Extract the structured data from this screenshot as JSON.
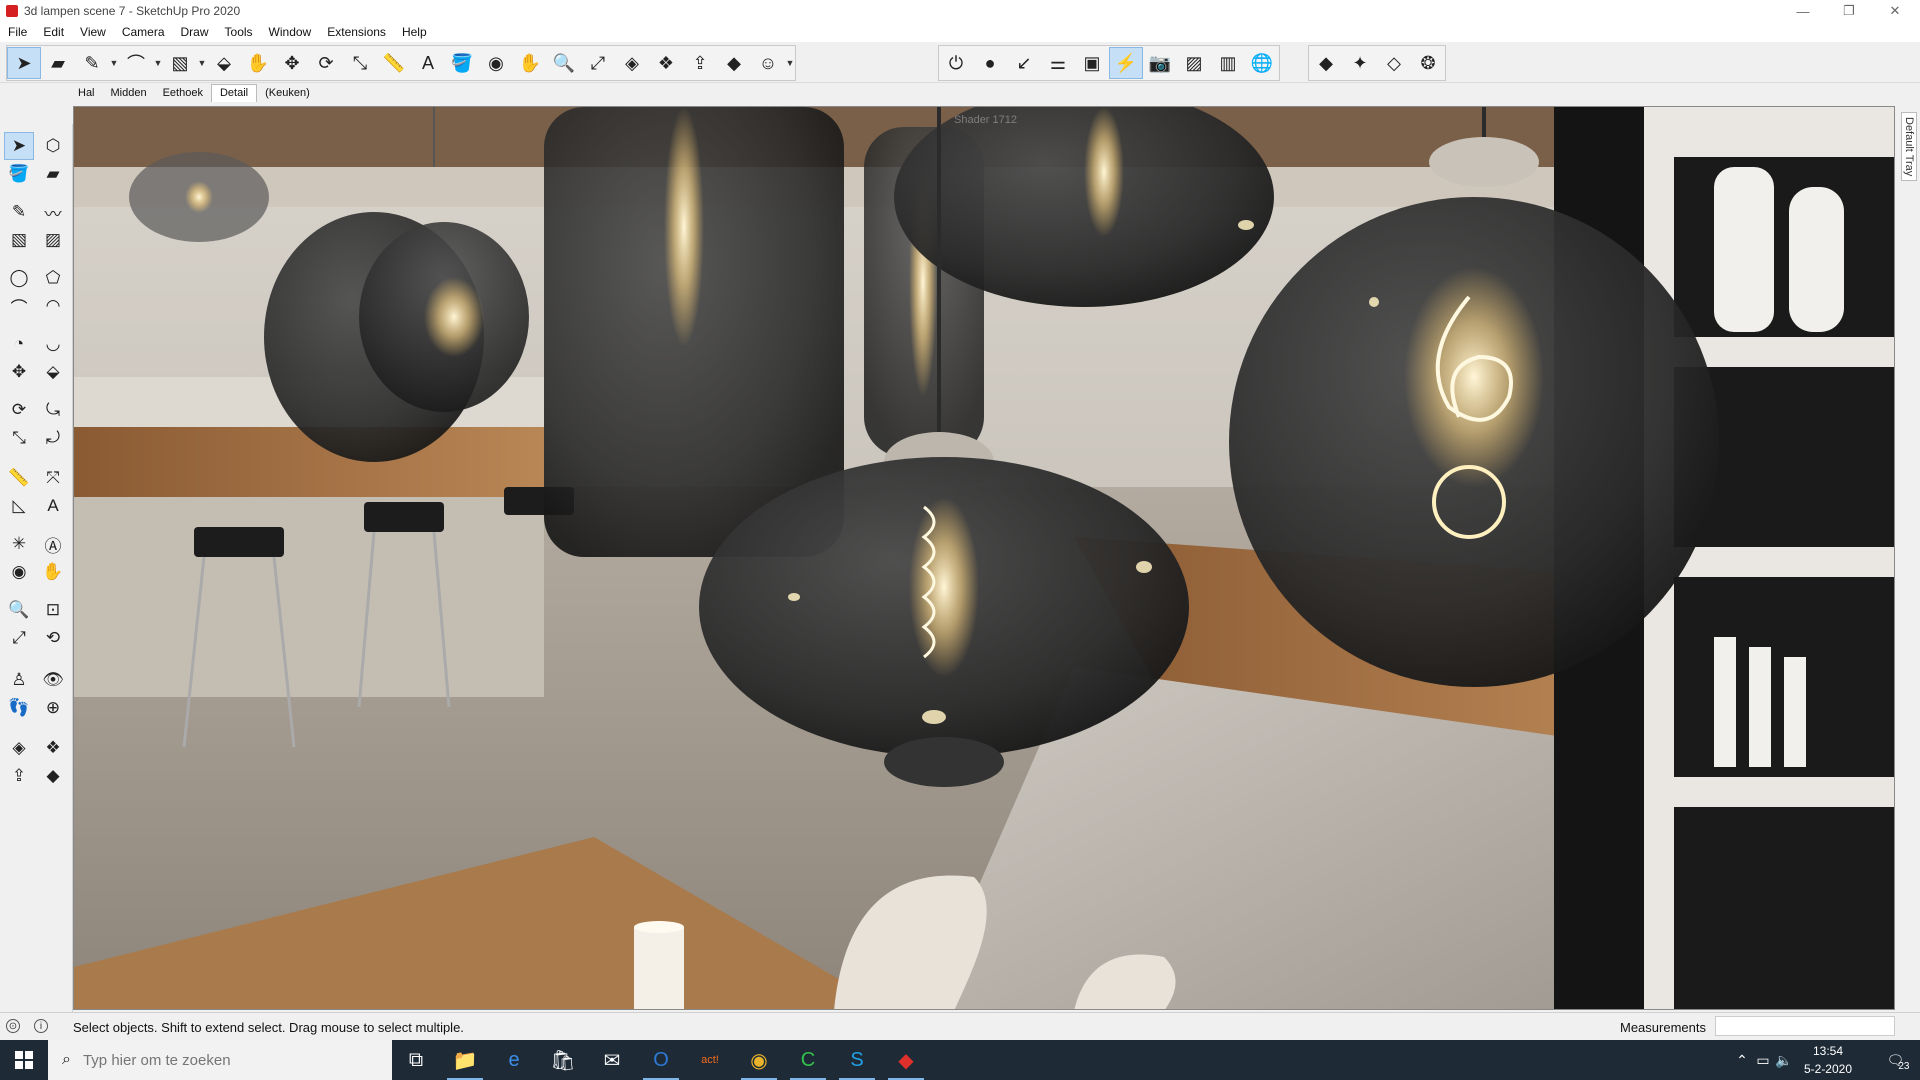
{
  "window": {
    "title": "3d lampen scene 7 - SketchUp Pro 2020",
    "controls": {
      "minimize": "—",
      "maximize": "❐",
      "close": "✕"
    }
  },
  "menu": [
    "File",
    "Edit",
    "View",
    "Camera",
    "Draw",
    "Tools",
    "Window",
    "Extensions",
    "Help"
  ],
  "toolbar": {
    "groups": [
      {
        "items": [
          {
            "icon": "select-icon",
            "glyph": "➤",
            "selected": true
          },
          {
            "icon": "eraser-icon",
            "glyph": "▰"
          },
          {
            "icon": "pencil-icon",
            "glyph": "✎"
          },
          {
            "icon": "dropdown-icon",
            "glyph": "▼",
            "dropdown": true
          },
          {
            "icon": "arc-icon",
            "glyph": "⌒"
          },
          {
            "icon": "dropdown-icon",
            "glyph": "▼",
            "dropdown": true
          },
          {
            "icon": "rectangle-icon",
            "glyph": "▧"
          },
          {
            "icon": "dropdown-icon",
            "glyph": "▼",
            "dropdown": true
          },
          {
            "icon": "push-pull-icon",
            "glyph": "⬙"
          },
          {
            "icon": "follow-me-icon",
            "glyph": "✋"
          },
          {
            "icon": "move-icon",
            "glyph": "✥"
          },
          {
            "icon": "rotate-icon",
            "glyph": "⟳"
          },
          {
            "icon": "scale-icon",
            "glyph": "⤡"
          },
          {
            "icon": "tape-measure-icon",
            "glyph": "📏"
          },
          {
            "icon": "text-icon",
            "glyph": "A"
          },
          {
            "icon": "paint-bucket-icon",
            "glyph": "🪣"
          },
          {
            "icon": "orbit-icon",
            "glyph": "◉"
          },
          {
            "icon": "pan-icon",
            "glyph": "✋"
          },
          {
            "icon": "zoom-icon",
            "glyph": "🔍"
          },
          {
            "icon": "zoom-extents-icon",
            "glyph": "⤢"
          },
          {
            "icon": "warehouse-icon",
            "glyph": "◈"
          },
          {
            "icon": "components-icon",
            "glyph": "❖"
          },
          {
            "icon": "share-model-icon",
            "glyph": "⇪"
          },
          {
            "icon": "extension-warehouse-icon",
            "glyph": "◆"
          },
          {
            "icon": "account-icon",
            "glyph": "☺"
          },
          {
            "icon": "dropdown-icon",
            "glyph": "▼",
            "dropdown": true
          }
        ]
      },
      {
        "items": [
          {
            "icon": "power-icon",
            "glyph": "⏻"
          },
          {
            "icon": "render-icon",
            "glyph": "●"
          },
          {
            "icon": "region-icon",
            "glyph": "↙"
          },
          {
            "icon": "settings-sliders-icon",
            "glyph": "⚌"
          },
          {
            "icon": "frame-buffer-icon",
            "glyph": "▣"
          },
          {
            "icon": "interactive-icon",
            "glyph": "⚡",
            "selected": true
          },
          {
            "icon": "camera-icon",
            "glyph": "📷"
          },
          {
            "icon": "image-icon",
            "glyph": "▨"
          },
          {
            "icon": "chart-icon",
            "glyph": "▥"
          },
          {
            "icon": "globe-icon",
            "glyph": "🌐"
          }
        ]
      },
      {
        "items": [
          {
            "icon": "light-icon",
            "glyph": "◆"
          },
          {
            "icon": "light-mesh-icon",
            "glyph": "✦"
          },
          {
            "icon": "proxy-icon",
            "glyph": "◇"
          },
          {
            "icon": "infinite-plane-icon",
            "glyph": "❂"
          }
        ]
      }
    ]
  },
  "scenes": [
    {
      "label": "Hal",
      "active": false
    },
    {
      "label": "Midden",
      "active": false
    },
    {
      "label": "Eethoek",
      "active": false
    },
    {
      "label": "Detail",
      "active": true
    },
    {
      "label": "(Keuken)",
      "active": false
    }
  ],
  "left_tools": [
    [
      "select-icon",
      "➤"
    ],
    [
      "make-component-icon",
      "⬡"
    ],
    [
      "paint-bucket-icon",
      "🪣"
    ],
    [
      "eraser-icon",
      "▰"
    ],
    [
      "line-icon",
      "✎"
    ],
    [
      "freehand-icon",
      "〰"
    ],
    [
      "rectangle-icon",
      "▧"
    ],
    [
      "rotated-rectangle-icon",
      "▨"
    ],
    [
      "circle-icon",
      "◯"
    ],
    [
      "polygon-icon",
      "⬠"
    ],
    [
      "arc-icon",
      "⌒"
    ],
    [
      "two-point-arc-icon",
      "◠"
    ],
    [
      "pie-icon",
      "◔"
    ],
    [
      "three-point-arc-icon",
      "◡"
    ],
    [
      "move-icon",
      "✥"
    ],
    [
      "push-pull-icon",
      "⬙"
    ],
    [
      "rotate-icon",
      "⟳"
    ],
    [
      "follow-me-icon",
      "⤿"
    ],
    [
      "scale-icon",
      "⤡"
    ],
    [
      "offset-icon",
      "⤾"
    ],
    [
      "tape-measure-icon",
      "📏"
    ],
    [
      "dimension-icon",
      "⤧"
    ],
    [
      "protractor-icon",
      "◺"
    ],
    [
      "text-icon",
      "A"
    ],
    [
      "axes-icon",
      "✳"
    ],
    [
      "3d-text-icon",
      "Ⓐ"
    ],
    [
      "orbit-icon",
      "◉"
    ],
    [
      "pan-icon",
      "✋"
    ],
    [
      "zoom-icon",
      "🔍"
    ],
    [
      "zoom-window-icon",
      "⊡"
    ],
    [
      "zoom-extents-icon",
      "⤢"
    ],
    [
      "previous-view-icon",
      "⟲"
    ],
    [
      "position-camera-icon",
      "♙"
    ],
    [
      "look-around-icon",
      "👁"
    ],
    [
      "walk-icon",
      "👣"
    ],
    [
      "section-plane-icon",
      "⊕"
    ],
    [
      "warehouse-icon",
      "◈"
    ],
    [
      "components-icon",
      "❖"
    ],
    [
      "share-model-icon",
      "⇪"
    ],
    [
      "extension-warehouse-icon",
      "◆"
    ]
  ],
  "viewport": {
    "overlay_text": "Shader 1712"
  },
  "tray": {
    "label": "Default Tray"
  },
  "status": {
    "text": "Select objects. Shift to extend select. Drag mouse to select multiple.",
    "measurements_label": "Measurements",
    "measurements_value": ""
  },
  "taskbar": {
    "search_placeholder": "Typ hier om te zoeken",
    "apps": [
      {
        "icon": "task-view-icon",
        "glyph": "⧉",
        "color": "#ffffff",
        "open": false
      },
      {
        "icon": "file-explorer-icon",
        "glyph": "📁",
        "color": "#f3c23c",
        "open": true
      },
      {
        "icon": "edge-icon",
        "glyph": "e",
        "color": "#3c8ee8",
        "open": false
      },
      {
        "icon": "store-icon",
        "glyph": "🛍",
        "color": "#ffffff",
        "open": false
      },
      {
        "icon": "mail-icon",
        "glyph": "✉",
        "color": "#ffffff",
        "open": false
      },
      {
        "icon": "outlook-icon",
        "glyph": "O",
        "color": "#2d7ad6",
        "open": true
      },
      {
        "icon": "act-icon",
        "glyph": "act!",
        "color": "#f26b1d",
        "open": false
      },
      {
        "icon": "chrome-icon",
        "glyph": "◉",
        "color": "#e8b32a",
        "open": true
      },
      {
        "icon": "camtasia-icon",
        "glyph": "C",
        "color": "#33c04a",
        "open": true
      },
      {
        "icon": "skype-icon",
        "glyph": "S",
        "color": "#1fa0e3",
        "open": true
      },
      {
        "icon": "sketchup-icon",
        "glyph": "◆",
        "color": "#e0302b",
        "open": true
      }
    ],
    "tray_icons": [
      "chevron-up-icon",
      "network-icon",
      "volume-icon"
    ],
    "time": "13:54",
    "date": "5-2-2020",
    "notification_count": "23"
  }
}
